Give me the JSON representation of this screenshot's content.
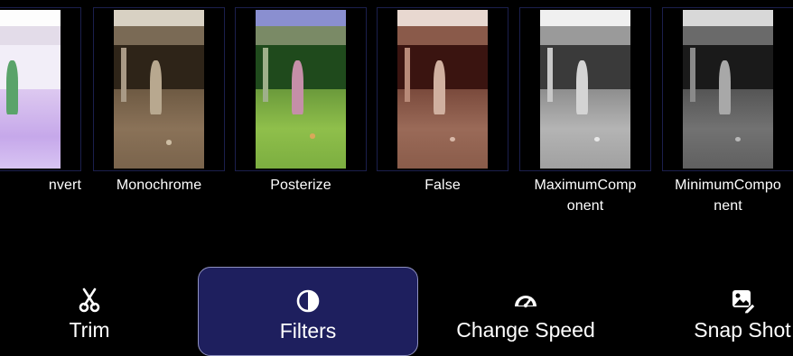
{
  "filters": [
    {
      "label": "nvert"
    },
    {
      "label": "Monochrome"
    },
    {
      "label": "Posterize"
    },
    {
      "label": "False"
    },
    {
      "label": "MaximumComp\nonent"
    },
    {
      "label": "MinimumCompo\nnent"
    }
  ],
  "toolbar": {
    "items": [
      {
        "label": "Trim",
        "icon": "scissors-icon",
        "selected": false
      },
      {
        "label": "Filters",
        "icon": "half-circle-contrast-icon",
        "selected": true
      },
      {
        "label": "Change Speed",
        "icon": "speedometer-icon",
        "selected": false
      },
      {
        "label": "Snap Shot",
        "icon": "photo-edit-icon",
        "selected": false
      }
    ]
  },
  "colors": {
    "background": "#000000",
    "selected_tool_bg": "#1e1f5e",
    "selected_tool_border": "#8f91c0",
    "thumb_border": "#1b1f4d"
  }
}
